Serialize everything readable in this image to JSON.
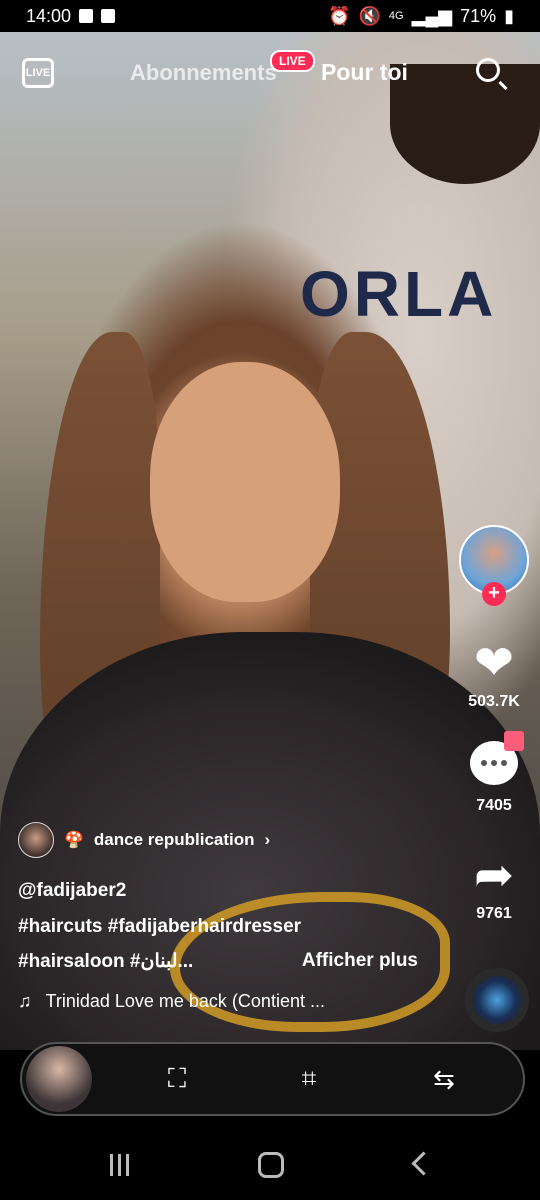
{
  "status_bar": {
    "time": "14:00",
    "battery": "71%",
    "network": "4G"
  },
  "top_nav": {
    "live_label": "LIVE",
    "following_tab": "Abonnements",
    "live_badge": "LIVE",
    "for_you_tab": "Pour toi"
  },
  "actions": {
    "likes": "503.7K",
    "comments": "7405",
    "shares": "9761"
  },
  "caption": {
    "sound_name": "dance republication",
    "username": "@fadijaber2",
    "tags_line1": "#haircuts #fadijaberhairdresser",
    "tags_line2": "#hairsaloon #لبنان...",
    "see_more": "Afficher plus",
    "music": "Trinidad Love me back (Contient ..."
  },
  "colors": {
    "accent": "#fe2c55",
    "cape_gold": "#d19b25"
  }
}
